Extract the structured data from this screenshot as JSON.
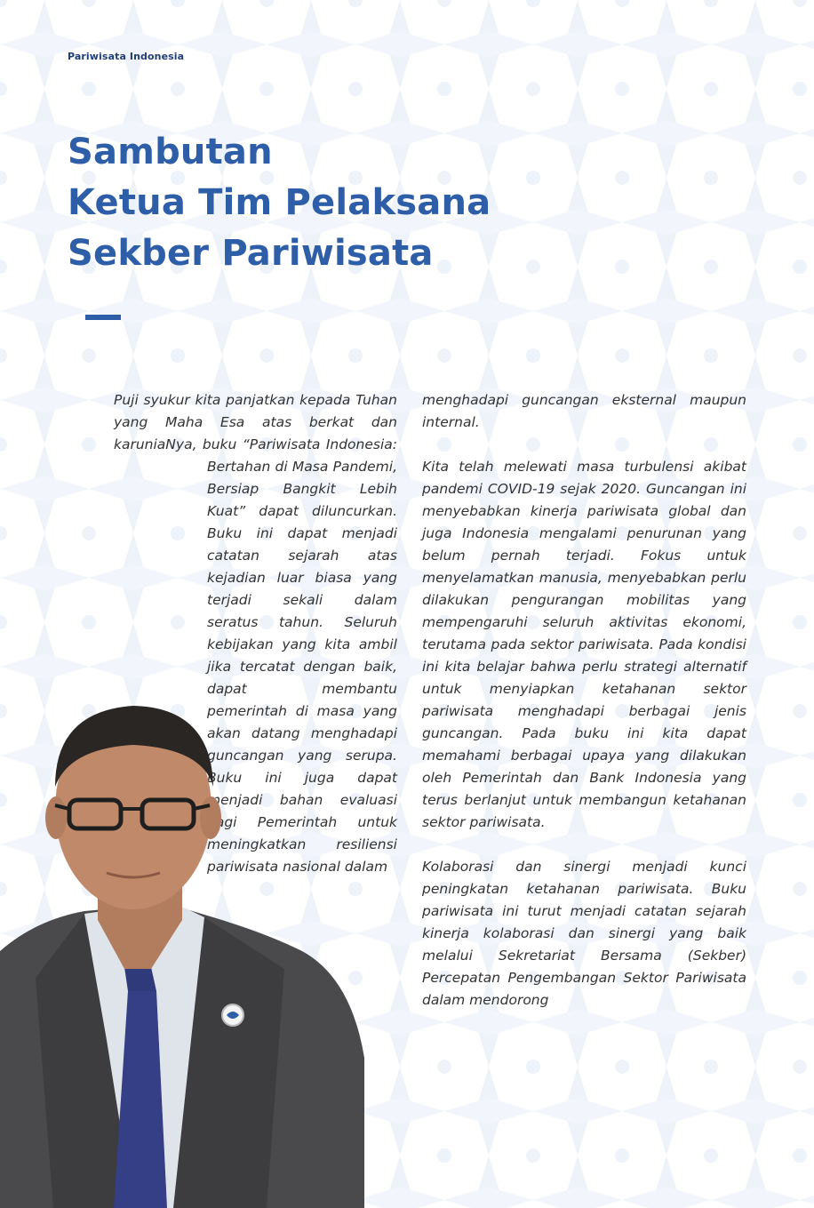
{
  "header": {
    "label": "Pariwisata Indonesia"
  },
  "title": {
    "line1": "Sambutan",
    "line2": "Ketua Tim Pelaksana",
    "line3": "Sekber Pariwisata"
  },
  "left_column": {
    "paragraph": "Puji syukur kita panjatkan kepada Tuhan yang Maha Esa atas berkat dan karuniaNya, buku “Pariwisata Indonesia: Bertahan di Masa Pandemi, Bersiap Bangkit Lebih Kuat” dapat diluncurkan. Buku ini dapat menjadi catatan sejarah atas kejadian luar biasa yang terjadi sekali dalam seratus tahun. Seluruh kebijakan yang kita ambil jika tercatat dengan baik, dapat membantu pemerintah di masa yang akan datang menghadapi guncangan yang serupa. Buku ini juga dapat menjadi bahan evaluasi bagi Pemerintah untuk meningkatkan resiliensi pariwisata nasional dalam"
  },
  "right_column": {
    "paragraphs": [
      "menghadapi guncangan eksternal maupun internal.",
      "Kita telah melewati masa turbulensi akibat pandemi COVID-19 sejak 2020. Guncangan ini menyebabkan kinerja pariwisata global dan juga Indonesia mengalami penurunan yang belum pernah terjadi. Fokus untuk menyelamatkan manusia, menyebabkan perlu dilakukan pengurangan mobilitas yang mempengaruhi seluruh aktivitas ekonomi, terutama pada sektor pariwisata. Pada kondisi ini kita belajar bahwa perlu strategi alternatif untuk menyiapkan ketahanan sektor pariwisata menghadapi berbagai jenis guncangan. Pada buku ini kita dapat memahami berbagai upaya yang dilakukan oleh Pemerintah dan Bank Indonesia yang terus berlanjut untuk membangun ketahanan sektor pariwisata.",
      "Kolaborasi dan sinergi menjadi kunci peningkatan ketahanan pariwisata. Buku pariwisata ini turut menjadi catatan sejarah kinerja kolaborasi dan sinergi yang baik melalui Sekretariat Bersama (Sekber) Percepatan Pengembangan Sektor Pariwisata dalam mendorong"
    ]
  },
  "colors": {
    "title": "#2e5ea8",
    "header": "#1f3f7a",
    "body_text": "#333333",
    "pattern": "#eef2f9"
  },
  "icons": {
    "portrait": "person-portrait-icon",
    "pin": "lapel-pin-icon"
  }
}
